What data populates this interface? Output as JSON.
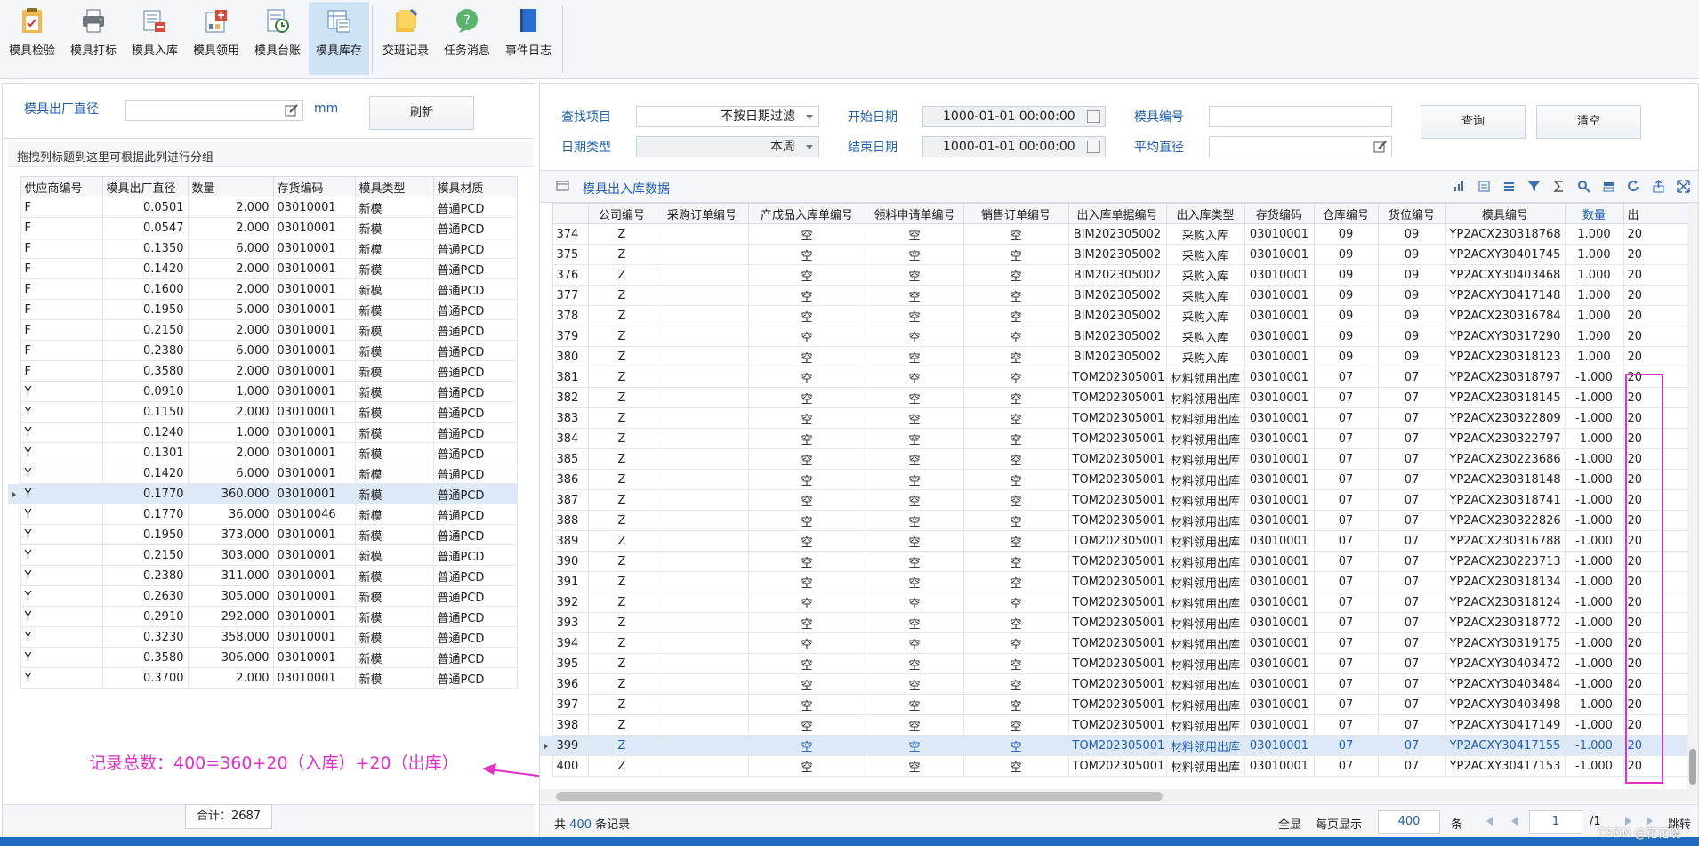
{
  "toolbar": {
    "buttons": [
      {
        "label": "模具检验",
        "icon": "inspection-icon"
      },
      {
        "label": "模具打标",
        "icon": "printer-icon"
      },
      {
        "label": "模具入库",
        "icon": "stock-in-icon"
      },
      {
        "label": "模具领用",
        "icon": "requisition-icon"
      },
      {
        "label": "模具台账",
        "icon": "ledger-icon"
      },
      {
        "label": "模具库存",
        "icon": "inventory-icon",
        "active": true
      },
      {
        "label": "交班记录",
        "icon": "shift-note-icon"
      },
      {
        "label": "任务消息",
        "icon": "message-icon"
      },
      {
        "label": "事件日志",
        "icon": "log-book-icon"
      }
    ]
  },
  "left": {
    "filter_label": "模具出厂直径",
    "filter_value": "",
    "unit": "mm",
    "refresh_label": "刷新",
    "group_hint": "拖拽列标题到这里可根据此列进行分组",
    "columns": [
      "供应商编号",
      "模具出厂直径",
      "数量",
      "存货编码",
      "模具类型",
      "模具材质"
    ],
    "rows": [
      [
        "F",
        "0.0501",
        "2.000",
        "03010001",
        "新模",
        "普通PCD"
      ],
      [
        "F",
        "0.0547",
        "2.000",
        "03010001",
        "新模",
        "普通PCD"
      ],
      [
        "F",
        "0.1350",
        "6.000",
        "03010001",
        "新模",
        "普通PCD"
      ],
      [
        "F",
        "0.1420",
        "2.000",
        "03010001",
        "新模",
        "普通PCD"
      ],
      [
        "F",
        "0.1600",
        "2.000",
        "03010001",
        "新模",
        "普通PCD"
      ],
      [
        "F",
        "0.1950",
        "5.000",
        "03010001",
        "新模",
        "普通PCD"
      ],
      [
        "F",
        "0.2150",
        "2.000",
        "03010001",
        "新模",
        "普通PCD"
      ],
      [
        "F",
        "0.2380",
        "6.000",
        "03010001",
        "新模",
        "普通PCD"
      ],
      [
        "F",
        "0.3580",
        "2.000",
        "03010001",
        "新模",
        "普通PCD"
      ],
      [
        "Y",
        "0.0910",
        "1.000",
        "03010001",
        "新模",
        "普通PCD"
      ],
      [
        "Y",
        "0.1150",
        "2.000",
        "03010001",
        "新模",
        "普通PCD"
      ],
      [
        "Y",
        "0.1240",
        "1.000",
        "03010001",
        "新模",
        "普通PCD"
      ],
      [
        "Y",
        "0.1301",
        "2.000",
        "03010001",
        "新模",
        "普通PCD"
      ],
      [
        "Y",
        "0.1420",
        "6.000",
        "03010001",
        "新模",
        "普通PCD"
      ],
      [
        "Y",
        "0.1770",
        "360.000",
        "03010001",
        "新模",
        "普通PCD"
      ],
      [
        "Y",
        "0.1770",
        "36.000",
        "03010046",
        "新模",
        "普通PCD"
      ],
      [
        "Y",
        "0.1950",
        "373.000",
        "03010001",
        "新模",
        "普通PCD"
      ],
      [
        "Y",
        "0.2150",
        "303.000",
        "03010001",
        "新模",
        "普通PCD"
      ],
      [
        "Y",
        "0.2380",
        "311.000",
        "03010001",
        "新模",
        "普通PCD"
      ],
      [
        "Y",
        "0.2630",
        "305.000",
        "03010001",
        "新模",
        "普通PCD"
      ],
      [
        "Y",
        "0.2910",
        "292.000",
        "03010001",
        "新模",
        "普通PCD"
      ],
      [
        "Y",
        "0.3230",
        "358.000",
        "03010001",
        "新模",
        "普通PCD"
      ],
      [
        "Y",
        "0.3580",
        "306.000",
        "03010001",
        "新模",
        "普通PCD"
      ],
      [
        "Y",
        "0.3700",
        "2.000",
        "03010001",
        "新模",
        "普通PCD"
      ]
    ],
    "selected_row": 14,
    "total_label": "合计：2687",
    "annotation": "记录总数：400=360+20（入库）+20（出库）"
  },
  "right": {
    "filter": {
      "find_label": "查找项目",
      "find_value": "不按日期过滤",
      "date_type_label": "日期类型",
      "date_type_value": "本周",
      "start_label": "开始日期",
      "start_value": "1000-01-01 00:00:00",
      "end_label": "结束日期",
      "end_value": "1000-01-01 00:00:00",
      "mold_no_label": "模具编号",
      "mold_no_value": "",
      "avg_dia_label": "平均直径",
      "avg_dia_value": "",
      "query_label": "查询",
      "clear_label": "清空"
    },
    "grid_title": "模具出入库数据",
    "columns": [
      "公司编号",
      "采购订单编号",
      "产成品入库单编号",
      "领料申请单编号",
      "销售订单编号",
      "出入库单据编号",
      "出入库类型",
      "存货编码",
      "仓库编号",
      "货位编号",
      "模具编号",
      "数量",
      "出"
    ],
    "empty_text": "空",
    "rows": [
      [
        "374",
        "Z",
        "",
        "空",
        "空",
        "空",
        "BIM202305002",
        "采购入库",
        "03010001",
        "09",
        "09",
        "YP2ACX230318768",
        "1.000",
        "20"
      ],
      [
        "375",
        "Z",
        "",
        "空",
        "空",
        "空",
        "BIM202305002",
        "采购入库",
        "03010001",
        "09",
        "09",
        "YP2ACXY30401745",
        "1.000",
        "20"
      ],
      [
        "376",
        "Z",
        "",
        "空",
        "空",
        "空",
        "BIM202305002",
        "采购入库",
        "03010001",
        "09",
        "09",
        "YP2ACXY30403468",
        "1.000",
        "20"
      ],
      [
        "377",
        "Z",
        "",
        "空",
        "空",
        "空",
        "BIM202305002",
        "采购入库",
        "03010001",
        "09",
        "09",
        "YP2ACXY30417148",
        "1.000",
        "20"
      ],
      [
        "378",
        "Z",
        "",
        "空",
        "空",
        "空",
        "BIM202305002",
        "采购入库",
        "03010001",
        "09",
        "09",
        "YP2ACX230316784",
        "1.000",
        "20"
      ],
      [
        "379",
        "Z",
        "",
        "空",
        "空",
        "空",
        "BIM202305002",
        "采购入库",
        "03010001",
        "09",
        "09",
        "YP2ACXY30317290",
        "1.000",
        "20"
      ],
      [
        "380",
        "Z",
        "",
        "空",
        "空",
        "空",
        "BIM202305002",
        "采购入库",
        "03010001",
        "09",
        "09",
        "YP2ACX230318123",
        "1.000",
        "20"
      ],
      [
        "381",
        "Z",
        "",
        "空",
        "空",
        "空",
        "TOM202305001",
        "材料领用出库",
        "03010001",
        "07",
        "07",
        "YP2ACX230318797",
        "-1.000",
        "20"
      ],
      [
        "382",
        "Z",
        "",
        "空",
        "空",
        "空",
        "TOM202305001",
        "材料领用出库",
        "03010001",
        "07",
        "07",
        "YP2ACX230318145",
        "-1.000",
        "20"
      ],
      [
        "383",
        "Z",
        "",
        "空",
        "空",
        "空",
        "TOM202305001",
        "材料领用出库",
        "03010001",
        "07",
        "07",
        "YP2ACX230322809",
        "-1.000",
        "20"
      ],
      [
        "384",
        "Z",
        "",
        "空",
        "空",
        "空",
        "TOM202305001",
        "材料领用出库",
        "03010001",
        "07",
        "07",
        "YP2ACX230322797",
        "-1.000",
        "20"
      ],
      [
        "385",
        "Z",
        "",
        "空",
        "空",
        "空",
        "TOM202305001",
        "材料领用出库",
        "03010001",
        "07",
        "07",
        "YP2ACX230223686",
        "-1.000",
        "20"
      ],
      [
        "386",
        "Z",
        "",
        "空",
        "空",
        "空",
        "TOM202305001",
        "材料领用出库",
        "03010001",
        "07",
        "07",
        "YP2ACX230318148",
        "-1.000",
        "20"
      ],
      [
        "387",
        "Z",
        "",
        "空",
        "空",
        "空",
        "TOM202305001",
        "材料领用出库",
        "03010001",
        "07",
        "07",
        "YP2ACX230318741",
        "-1.000",
        "20"
      ],
      [
        "388",
        "Z",
        "",
        "空",
        "空",
        "空",
        "TOM202305001",
        "材料领用出库",
        "03010001",
        "07",
        "07",
        "YP2ACX230322826",
        "-1.000",
        "20"
      ],
      [
        "389",
        "Z",
        "",
        "空",
        "空",
        "空",
        "TOM202305001",
        "材料领用出库",
        "03010001",
        "07",
        "07",
        "YP2ACX230316788",
        "-1.000",
        "20"
      ],
      [
        "390",
        "Z",
        "",
        "空",
        "空",
        "空",
        "TOM202305001",
        "材料领用出库",
        "03010001",
        "07",
        "07",
        "YP2ACX230223713",
        "-1.000",
        "20"
      ],
      [
        "391",
        "Z",
        "",
        "空",
        "空",
        "空",
        "TOM202305001",
        "材料领用出库",
        "03010001",
        "07",
        "07",
        "YP2ACX230318134",
        "-1.000",
        "20"
      ],
      [
        "392",
        "Z",
        "",
        "空",
        "空",
        "空",
        "TOM202305001",
        "材料领用出库",
        "03010001",
        "07",
        "07",
        "YP2ACX230318124",
        "-1.000",
        "20"
      ],
      [
        "393",
        "Z",
        "",
        "空",
        "空",
        "空",
        "TOM202305001",
        "材料领用出库",
        "03010001",
        "07",
        "07",
        "YP2ACX230318772",
        "-1.000",
        "20"
      ],
      [
        "394",
        "Z",
        "",
        "空",
        "空",
        "空",
        "TOM202305001",
        "材料领用出库",
        "03010001",
        "07",
        "07",
        "YP2ACXY30319175",
        "-1.000",
        "20"
      ],
      [
        "395",
        "Z",
        "",
        "空",
        "空",
        "空",
        "TOM202305001",
        "材料领用出库",
        "03010001",
        "07",
        "07",
        "YP2ACXY30403472",
        "-1.000",
        "20"
      ],
      [
        "396",
        "Z",
        "",
        "空",
        "空",
        "空",
        "TOM202305001",
        "材料领用出库",
        "03010001",
        "07",
        "07",
        "YP2ACXY30403484",
        "-1.000",
        "20"
      ],
      [
        "397",
        "Z",
        "",
        "空",
        "空",
        "空",
        "TOM202305001",
        "材料领用出库",
        "03010001",
        "07",
        "07",
        "YP2ACXY30403498",
        "-1.000",
        "20"
      ],
      [
        "398",
        "Z",
        "",
        "空",
        "空",
        "空",
        "TOM202305001",
        "材料领用出库",
        "03010001",
        "07",
        "07",
        "YP2ACXY30417149",
        "-1.000",
        "20"
      ],
      [
        "399",
        "Z",
        "",
        "空",
        "空",
        "空",
        "TOM202305001",
        "材料领用出库",
        "03010001",
        "07",
        "07",
        "YP2ACXY30417155",
        "-1.000",
        "20"
      ],
      [
        "400",
        "Z",
        "",
        "空",
        "空",
        "空",
        "TOM202305001",
        "材料领用出库",
        "03010001",
        "07",
        "07",
        "YP2ACXY30417153",
        "-1.000",
        "20"
      ]
    ],
    "selected_row": 25,
    "footer": {
      "records_prefix": "共",
      "records_count": "400",
      "records_suffix": "条记录",
      "show_all": "全显",
      "per_page_label": "每页显示",
      "per_page_value": "400",
      "per_page_unit": "条",
      "page_value": "1",
      "page_total": "/1",
      "jump_label": "跳转"
    }
  },
  "watermark": "CSDN @花花晓",
  "colors": {
    "accent": "#1e5eb4",
    "highlight": "#e030c8",
    "selected_row": "#dde9f6",
    "active_tool": "#cfe3f7"
  }
}
